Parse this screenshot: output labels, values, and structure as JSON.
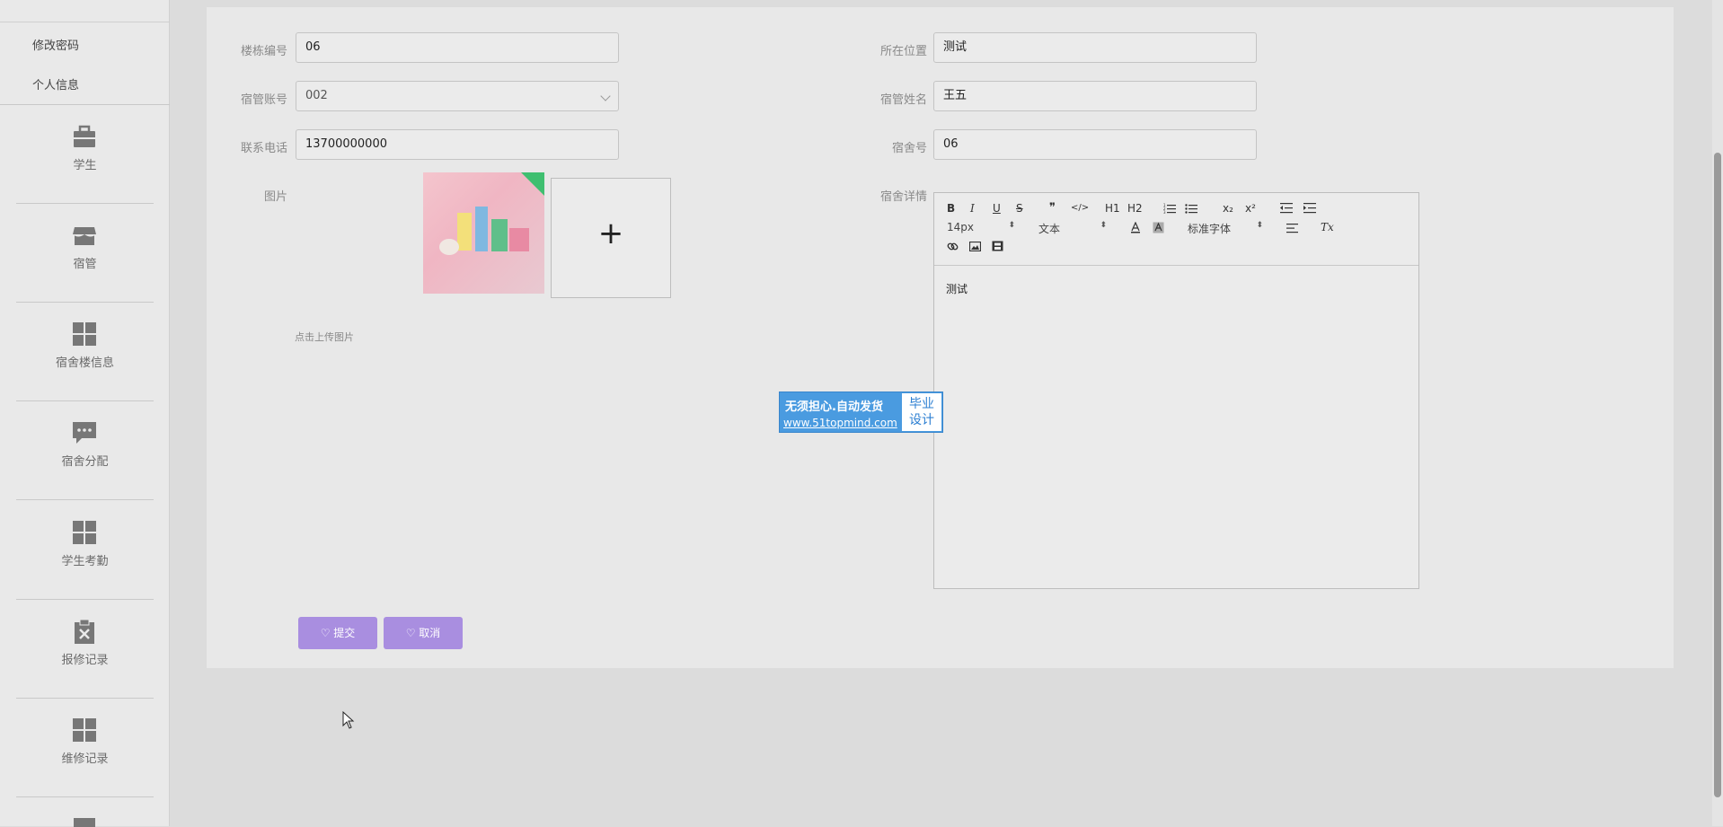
{
  "sidebar": {
    "top_links": [
      "修改密码",
      "个人信息"
    ],
    "items": [
      {
        "label": "学生",
        "icon": "briefcase-icon"
      },
      {
        "label": "宿管",
        "icon": "store-icon"
      },
      {
        "label": "宿舍楼信息",
        "icon": "grid-icon"
      },
      {
        "label": "宿舍分配",
        "icon": "chat-icon"
      },
      {
        "label": "学生考勤",
        "icon": "grid-icon"
      },
      {
        "label": "报修记录",
        "icon": "clipboard-x-icon"
      },
      {
        "label": "维修记录",
        "icon": "grid-icon"
      }
    ]
  },
  "form": {
    "building_no": {
      "label": "楼栋编号",
      "value": "06"
    },
    "location": {
      "label": "所在位置",
      "value": "测试"
    },
    "manager_account": {
      "label": "宿管账号",
      "value": "002"
    },
    "manager_name": {
      "label": "宿管姓名",
      "value": "王五"
    },
    "phone": {
      "label": "联系电话",
      "value": "13700000000"
    },
    "room_no": {
      "label": "宿舍号",
      "value": "06"
    },
    "image": {
      "label": "图片",
      "upload_hint": "点击上传图片",
      "plus": "+"
    },
    "details": {
      "label": "宿舍详情",
      "content": "测试"
    }
  },
  "editor": {
    "font_size": "14px",
    "heading": "文本",
    "font_family": "标准字体",
    "tools": [
      "B",
      "I",
      "U",
      "S",
      "❞",
      "</>",
      "H1",
      "H2",
      "x₂",
      "x²",
      "Tx"
    ]
  },
  "buttons": {
    "submit": "提交",
    "cancel": "取消",
    "icon": "heart-icon"
  },
  "watermark": {
    "line1": "无须担心.自动发货",
    "line2": "www.51topmind.com",
    "badge1": "毕业",
    "badge2": "设计"
  },
  "colors": {
    "accent": "#a98ee0",
    "watermark": "#4a9be0",
    "badge": "#3fbf70"
  }
}
